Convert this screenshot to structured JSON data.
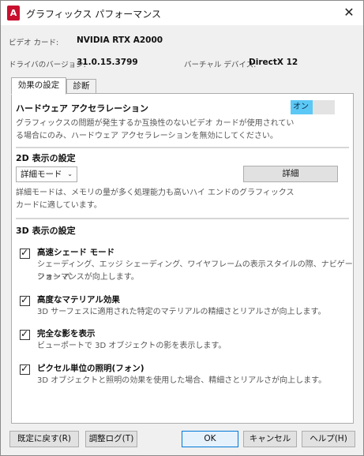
{
  "window": {
    "title": "グラフィックス パフォーマンス",
    "app_icon": "autocad-icon",
    "close_icon": "close-icon",
    "close_glyph": "✕"
  },
  "app_icon_text": "A",
  "info": {
    "video_card_label": "ビデオ カード:",
    "video_card_value": "NVIDIA RTX A2000",
    "driver_label": "ドライバのバージョン:",
    "driver_value": "31.0.15.3799",
    "virtual_device_label": "バーチャル デバイス:",
    "virtual_device_value": "DirectX 12"
  },
  "tabs": [
    {
      "label": "効果の設定",
      "active": true
    },
    {
      "label": "診断",
      "active": false
    }
  ],
  "hardware": {
    "title": "ハードウェア アクセラレーション",
    "toggle_label": "オン",
    "toggle_state": "on",
    "desc_line1": "グラフィックスの問題が発生するか互換性のないビデオ カードが使用されてい",
    "desc_line2": "る場合にのみ、ハードウェア アクセラレーションを無効にしてください。"
  },
  "display2d": {
    "title": "2D 表示の設定",
    "mode_value": "詳細モード",
    "chevron": "⌄",
    "details_button": "詳細",
    "desc_line1": "詳細モードは、メモリの量が多く処理能力も高いハイ エンドのグラフィックス",
    "desc_line2": "カードに適しています。"
  },
  "display3d": {
    "title": "3D 表示の設定",
    "options": [
      {
        "title": "高速シェード モード",
        "checked": true,
        "desc_line1": "シェーディング、エッジ シェーディング、ワイヤフレームの表示スタイルの際、ナビゲーション パ",
        "desc_line2": "フォーマンスが向上します。"
      },
      {
        "title": "高度なマテリアル効果",
        "checked": true,
        "desc_line1": "3D サーフェスに適用された特定のマテリアルの精細さとリアルさが向上します。",
        "desc_line2": ""
      },
      {
        "title": "完全な影を表示",
        "checked": true,
        "desc_line1": "ビューポートで 3D オブジェクトの影を表示します。",
        "desc_line2": ""
      },
      {
        "title": "ピクセル単位の照明(フォン)",
        "checked": true,
        "desc_line1": "3D オブジェクトと照明の効果を使用した場合、精細さとリアルさが向上します。",
        "desc_line2": ""
      }
    ]
  },
  "checkmark": "✓",
  "buttons": {
    "reset": "既定に戻す(R)",
    "tuning_log": "調整ログ(T)",
    "ok": "OK",
    "cancel": "キャンセル",
    "help": "ヘルプ(H)"
  },
  "colors": {
    "accent": "#0078d7",
    "toggle_on": "#5bc8f5",
    "app_icon": "#c8102e"
  }
}
